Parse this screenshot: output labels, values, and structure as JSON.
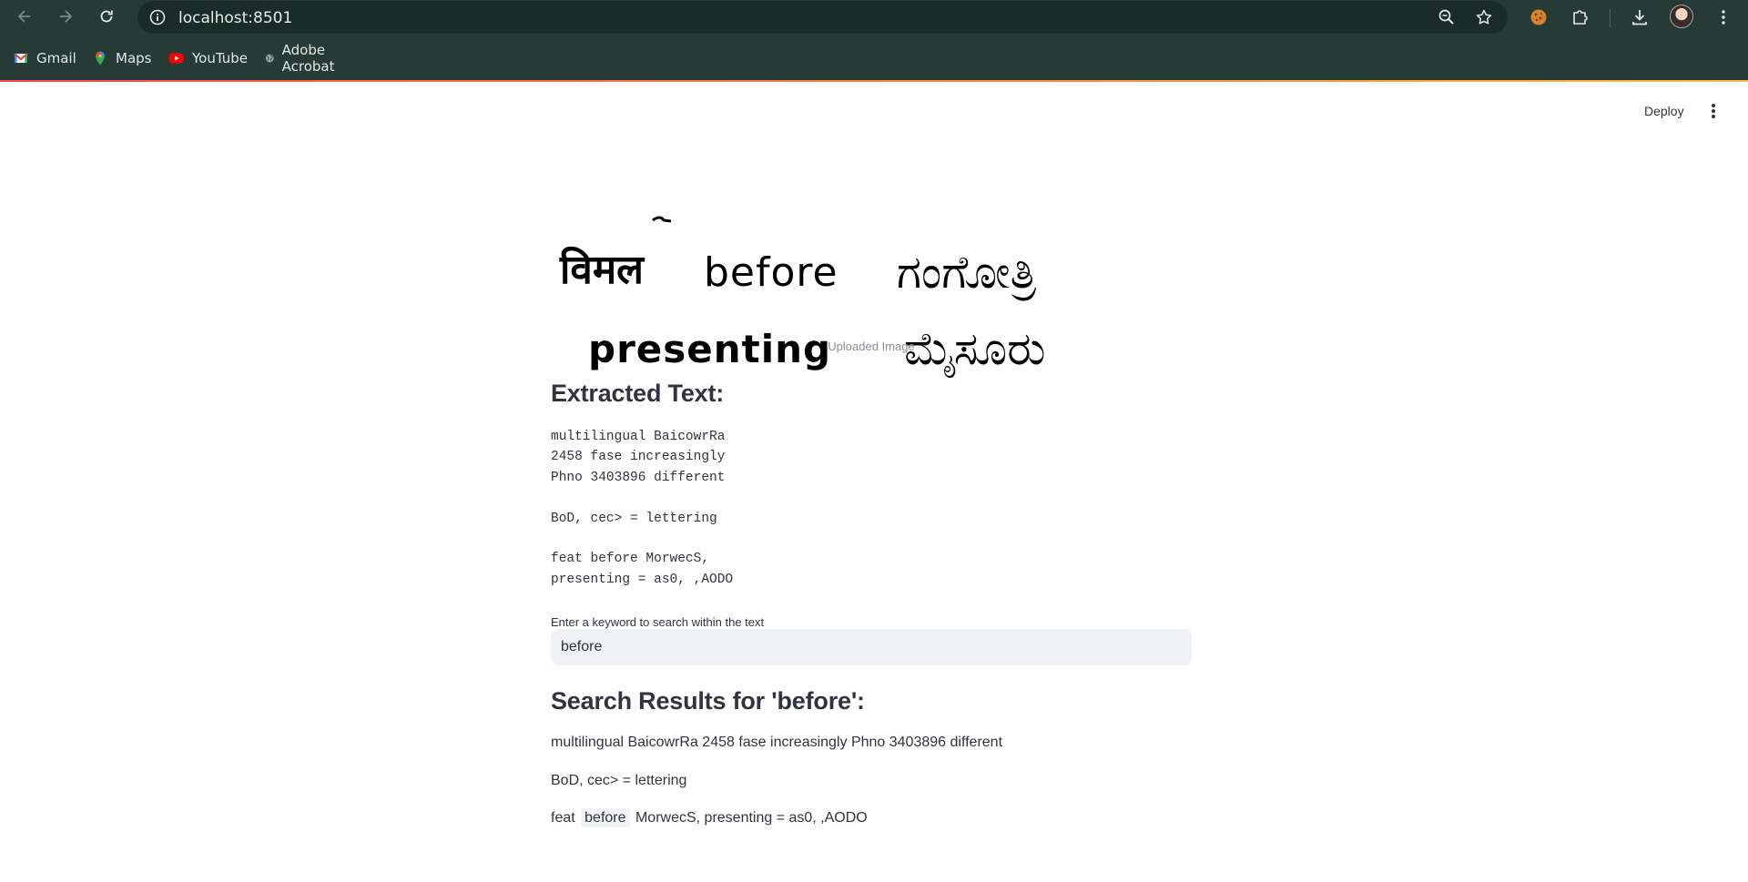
{
  "browser": {
    "url": "localhost:8501",
    "bookmarks": [
      {
        "label": "Gmail",
        "icon": "gmail-icon"
      },
      {
        "label": "Maps",
        "icon": "maps-icon"
      },
      {
        "label": "YouTube",
        "icon": "youtube-icon"
      },
      {
        "label": "Adobe Acrobat",
        "icon": "globe-icon"
      }
    ],
    "accent_line_colors": [
      "#ff4b4b",
      "#ffbd45"
    ]
  },
  "app": {
    "deploy_label": "Deploy",
    "image": {
      "words_row1": [
        "विमल",
        "before",
        "ಗಂಗೋತ್ರಿ"
      ],
      "words_row2": [
        "presenting",
        "ಮೈಸೂರು"
      ],
      "caption": "Uploaded Image"
    },
    "extracted_heading": "Extracted Text:",
    "extracted_lines": [
      "multilingual BaicowrRa",
      "2458 fase increasingly",
      "Phno 3403896 different",
      "",
      "BoD, cec> = lettering",
      "",
      "feat before MorwecS,",
      "presenting = as0, ,AODO"
    ],
    "search": {
      "label": "Enter a keyword to search within the text",
      "value": "before"
    },
    "results_heading": "Search Results for 'before':",
    "results": {
      "r1": "multilingual BaicowrRa 2458 fase increasingly Phno 3403896 different",
      "r2": "BoD, cec> = lettering",
      "r3_pre": "feat",
      "r3_match": "before",
      "r3_post": "MorwecS, presenting = as0, ,AODO"
    }
  }
}
